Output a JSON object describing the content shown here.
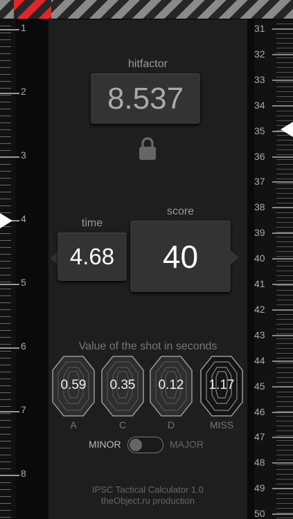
{
  "left_ruler": {
    "numbers": [
      "1",
      "2",
      "3",
      "4",
      "5",
      "6",
      "7",
      "8"
    ]
  },
  "right_ruler": {
    "numbers": [
      "31",
      "32",
      "33",
      "34",
      "35",
      "36",
      "37",
      "38",
      "39",
      "40",
      "41",
      "42",
      "43",
      "44",
      "45",
      "46",
      "47",
      "48",
      "49",
      "50"
    ]
  },
  "hitfactor": {
    "label": "hitfactor",
    "value": "8.537"
  },
  "time": {
    "label": "time",
    "value": "4.68"
  },
  "score": {
    "label": "score",
    "value": "40"
  },
  "shots": {
    "title": "Value of the shot in seconds",
    "items": [
      {
        "value": "0.59",
        "label": "A"
      },
      {
        "value": "0.35",
        "label": "C"
      },
      {
        "value": "0.12",
        "label": "D"
      },
      {
        "value": "1.17",
        "label": "MISS"
      }
    ]
  },
  "power_factor": {
    "minor": "MINOR",
    "major": "MAJOR"
  },
  "footer": {
    "line1": "IPSC Tactical Calculator 1.0",
    "line2": "theObject.ru production"
  },
  "colors": {
    "accent_red": "#e0262b",
    "background": "#1c1c1c"
  },
  "icons": {
    "lock": "lock-icon"
  }
}
